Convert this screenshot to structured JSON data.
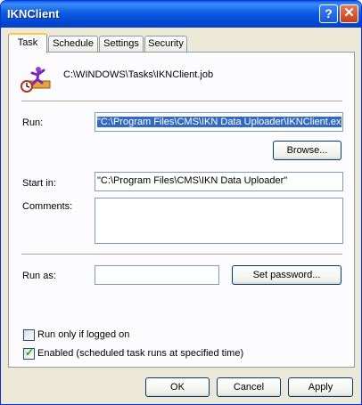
{
  "window": {
    "title": "IKNClient"
  },
  "tabs": [
    {
      "label": "Task"
    },
    {
      "label": "Schedule"
    },
    {
      "label": "Settings"
    },
    {
      "label": "Security"
    }
  ],
  "task": {
    "file_path": "C:\\WINDOWS\\Tasks\\IKNClient.job",
    "run_label": "Run:",
    "run_value": "\"C:\\Program Files\\CMS\\IKN Data Uploader\\IKNClient.ex",
    "browse_label": "Browse...",
    "start_in_label": "Start in:",
    "start_in_value": "\"C:\\Program Files\\CMS\\IKN Data Uploader\"",
    "comments_label": "Comments:",
    "comments_value": "",
    "run_as_label": "Run as:",
    "run_as_value": "",
    "set_password_label": "Set password...",
    "run_only_logged_on_label": "Run only if logged on",
    "run_only_logged_on_checked": false,
    "enabled_label": "Enabled (scheduled task runs at specified time)",
    "enabled_checked": true
  },
  "buttons": {
    "ok": "OK",
    "cancel": "Cancel",
    "apply": "Apply"
  },
  "titlebar": {
    "help_glyph": "?",
    "close_glyph": "✕"
  }
}
